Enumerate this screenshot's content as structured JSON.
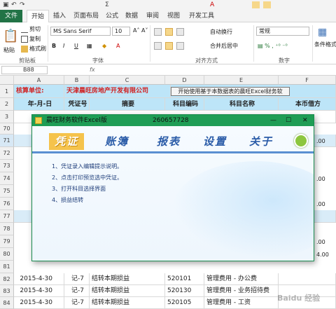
{
  "qat": {
    "undo": "↶",
    "redo": "↷",
    "sigma": "Σ"
  },
  "tabs": [
    "文件",
    "开始",
    "插入",
    "页面布局",
    "公式",
    "数据",
    "审阅",
    "视图",
    "开发工具"
  ],
  "ribbon": {
    "clipboard": {
      "cut": "剪切",
      "copy": "复制",
      "painter": "格式刷",
      "paste": "粘贴",
      "label": "剪贴板"
    },
    "font": {
      "name": "MS Sans Serif",
      "size": "10",
      "bold": "B",
      "italic": "I",
      "underline": "U",
      "label": "字体"
    },
    "align": {
      "wrap": "自动换行",
      "merge": "合并后居中",
      "label": "对齐方式"
    },
    "number": {
      "format": "常规",
      "label": "数字"
    },
    "styles": {
      "cond": "条件格式"
    }
  },
  "formula": {
    "namebox": "B88",
    "fx": "fx"
  },
  "columns": [
    "A",
    "B",
    "C",
    "D",
    "E",
    "F"
  ],
  "row1": {
    "label": "核算单位:",
    "company": "天津晨旺房地产开发有限公司",
    "button": "开始使用基于本数据表的晨旺Excel财务软"
  },
  "headers": [
    "年-月-日",
    "凭证号",
    "摘要",
    "科目编码",
    "科目名称",
    "本币借方"
  ],
  "rows_top": [
    "1",
    "2",
    "3",
    "70",
    "71",
    "72",
    "73",
    "74",
    "75",
    "76",
    "77",
    "78",
    "79",
    "80",
    "81"
  ],
  "right_values": {
    "70": ".00",
    "74": ".00",
    "76": ".00",
    "79": ".00",
    "80": "4.00"
  },
  "rows_bottom": [
    {
      "num": "82",
      "date": "2015-4-30",
      "voucher": "记-7",
      "summary": "结转本期损益",
      "code": "520101",
      "account": "管理费用 - 办公费"
    },
    {
      "num": "83",
      "date": "2015-4-30",
      "voucher": "记-7",
      "summary": "结转本期损益",
      "code": "520130",
      "account": "管理费用 - 业务招待费"
    },
    {
      "num": "84",
      "date": "2015-4-30",
      "voucher": "记-7",
      "summary": "结转本期损益",
      "code": "520105",
      "account": "管理费用 - 工资"
    }
  ],
  "dialog": {
    "title": "晨旺财务软件Excel版",
    "code": "260657728",
    "menu": [
      "凭证",
      "账簿",
      "报表",
      "设置",
      "关于"
    ],
    "help": [
      "1、凭证录入编辑提示说明。",
      "2、点击打印预览选中凭证。",
      "3、打开科目选择界面",
      "4、损益结转"
    ]
  },
  "watermark": "Baidu 经验",
  "colors": {
    "excel_green": "#217346",
    "title_green": "#1f9d55",
    "row_blue": "#bde5f8",
    "menu_blue": "#2b5ca8",
    "menu_sel": "#f5c34c"
  }
}
